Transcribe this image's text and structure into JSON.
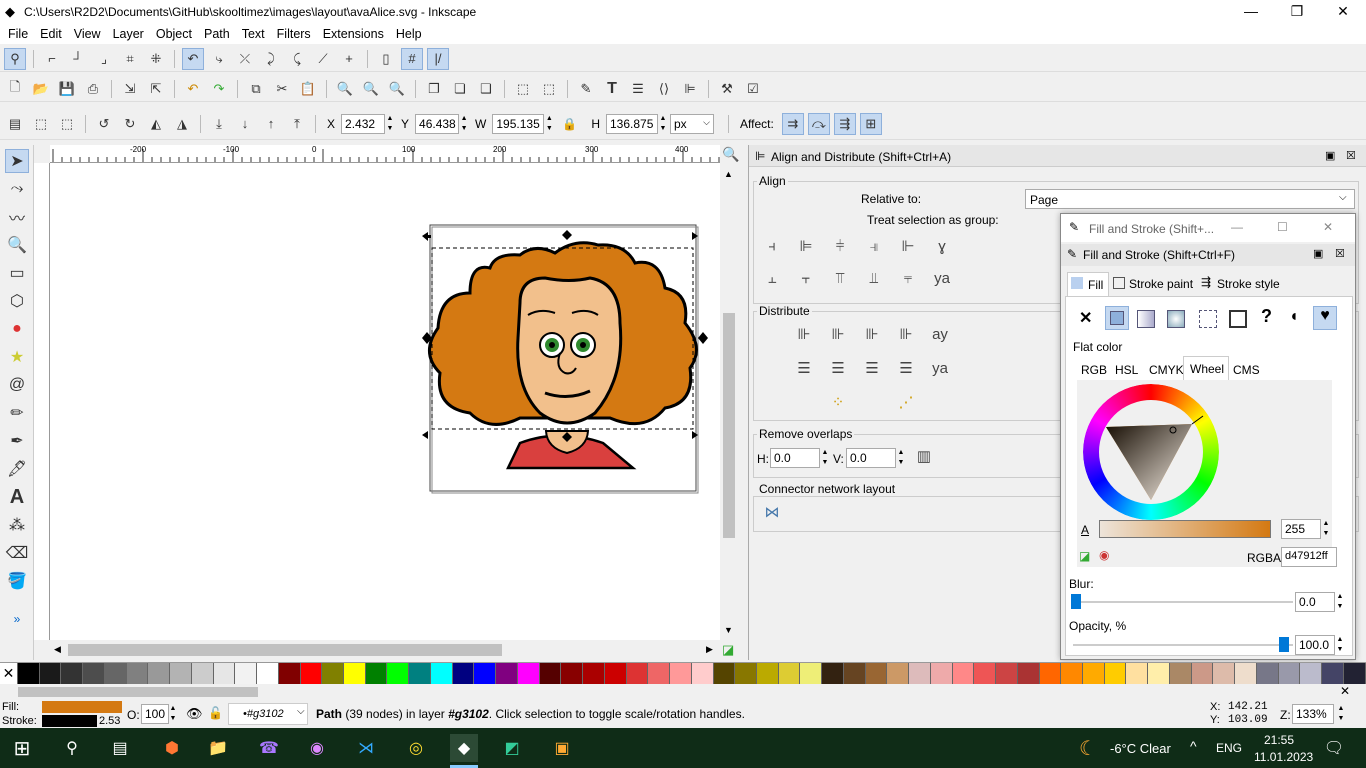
{
  "window": {
    "title": "C:\\Users\\R2D2\\Documents\\GitHub\\skooltimez\\images\\layout\\avaAlice.svg - Inkscape",
    "min": "—",
    "max": "❐",
    "close": "✕"
  },
  "menu": [
    "File",
    "Edit",
    "View",
    "Layer",
    "Object",
    "Path",
    "Text",
    "Filters",
    "Extensions",
    "Help"
  ],
  "toolbar_xywh": {
    "x_label": "X",
    "x": "2.432",
    "y_label": "Y",
    "y": "46.438",
    "w_label": "W",
    "w": "195.135",
    "h_label": "H",
    "h": "136.875",
    "unit": "px",
    "affect": "Affect:"
  },
  "ruler": {
    "ticks": [
      "-200",
      "-100",
      "0",
      "100",
      "200",
      "300",
      "400"
    ]
  },
  "align": {
    "title": "Align and Distribute (Shift+Ctrl+A)",
    "align_label": "Align",
    "relative_to": "Relative to:",
    "relative_value": "Page",
    "treat_group": "Treat selection as group:",
    "distribute": "Distribute",
    "remove_overlaps": "Remove overlaps",
    "h_label": "H:",
    "h_value": "0.0",
    "v_label": "V:",
    "v_value": "0.0",
    "connector": "Connector network layout"
  },
  "fillstroke": {
    "window_title": "Fill and Stroke (Shift+...",
    "panel_title": "Fill and Stroke (Shift+Ctrl+F)",
    "tabs": [
      "Fill",
      "Stroke paint",
      "Stroke style"
    ],
    "flat": "Flat color",
    "modes": [
      "RGB",
      "HSL",
      "CMYK",
      "Wheel",
      "CMS"
    ],
    "alpha_label": "A",
    "alpha": "255",
    "rgba_label": "RGBA:",
    "rgba": "d47912ff",
    "blur_label": "Blur:",
    "blur": "0.0",
    "opacity_label": "Opacity, %",
    "opacity": "100.0"
  },
  "status": {
    "fill_label": "Fill:",
    "stroke_label": "Stroke:",
    "stroke_w": "2.53",
    "o_label": "O:",
    "o_value": "100",
    "layer": "•#g3102",
    "message_a": "Path",
    "message_b": " (39 nodes) in layer ",
    "message_c": "#g3102",
    "message_d": ". Click selection to toggle scale/rotation handles.",
    "x_label": "X:",
    "x": "142.21",
    "y_label": "Y:",
    "y": "103.09",
    "z_label": "Z:",
    "zoom": "133%"
  },
  "taskbar": {
    "weather": "-6°C  Clear",
    "lang": "ENG",
    "time": "21:55",
    "date": "11.01.2023"
  },
  "colors": {
    "fill": "#d47912",
    "accent": "#0078d7"
  }
}
